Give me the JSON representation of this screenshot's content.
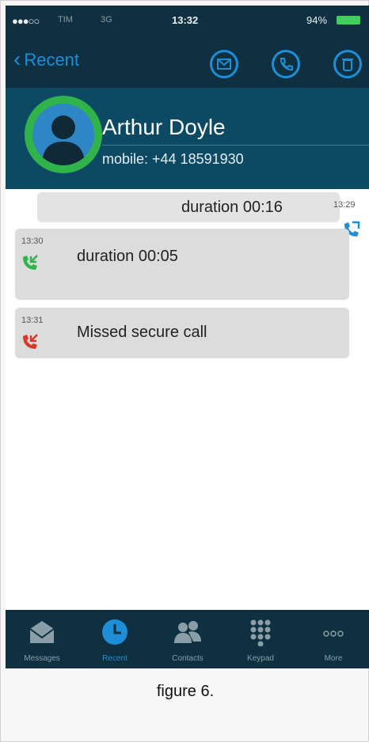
{
  "status_bar": {
    "signal": "●●●○○",
    "carrier": "TIM",
    "network": "3G",
    "time": "13:32",
    "battery": "94%"
  },
  "nav": {
    "back_label": "Recent"
  },
  "contact": {
    "name": "Arthur Doyle",
    "phone": "mobile: +44 18591930"
  },
  "calls": [
    {
      "duration": "duration 00:16",
      "time": "13:29",
      "direction": "outgoing",
      "color": "#1e8fd6"
    },
    {
      "duration": "duration 00:05",
      "time": "13:30",
      "direction": "incoming",
      "color": "#2fb34a"
    },
    {
      "duration": "Missed secure call",
      "time": "13:31",
      "direction": "missed",
      "color": "#d83a2a"
    }
  ],
  "tabs": [
    {
      "label": "Messages",
      "icon": "envelope-icon"
    },
    {
      "label": "Recent",
      "icon": "clock-icon",
      "active": true
    },
    {
      "label": "Contacts",
      "icon": "contacts-icon"
    },
    {
      "label": "Keypad",
      "icon": "keypad-icon"
    },
    {
      "label": "More",
      "icon": "more-icon"
    }
  ],
  "caption": "figure 6.",
  "colors": {
    "accent": "#1e8fd6",
    "header_bg": "#0f3040",
    "contact_bg": "#0c4a64",
    "incoming": "#2fb34a",
    "missed": "#d83a2a"
  }
}
